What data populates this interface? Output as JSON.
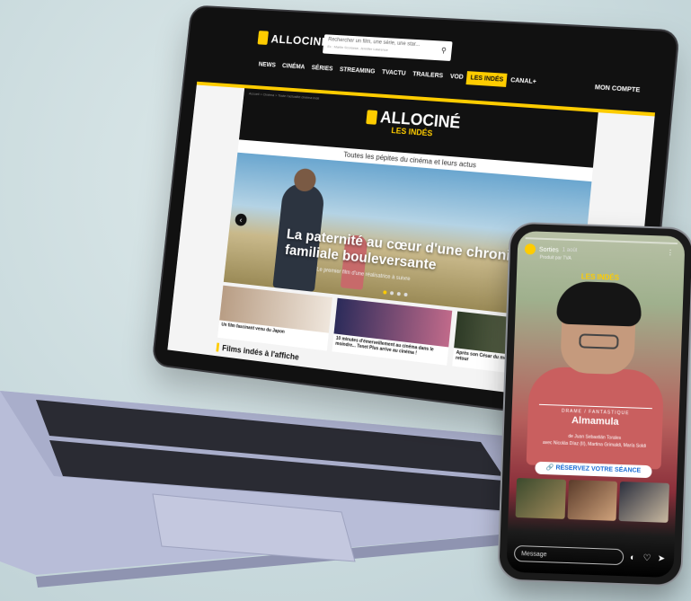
{
  "laptop": {
    "site": {
      "logo_text": "ALLOCINÉ",
      "search_placeholder": "Rechercher un film, une série, une star...",
      "search_hint": "Ex : Martin Scorsese, Jennifer Lawrence",
      "nav_items": [
        "NEWS",
        "CINÉMA",
        "SÉRIES",
        "STREAMING",
        "TVACTU",
        "TRAILERS",
        "VOD",
        "LES INDÉS",
        "CANAL+"
      ],
      "active_nav": "LES INDÉS",
      "account_label": "MON COMPTE",
      "breadcrumb": "Accueil > Cinéma > Toute l'actualité cinéma indé",
      "brand_main": "ALLOCINÉ",
      "brand_sub": "LES INDÉS",
      "tagline": "Toutes les pépites du cinéma et leurs actus",
      "hero_title": "La paternité au cœur d'une chronique familiale bouleversante",
      "hero_sub": "Le premier film d'une réalisatrice à suivre",
      "cards": [
        {
          "caption": "Un film fascinant venu du Japon"
        },
        {
          "caption": "10 minutes d'émerveillement au cinéma dans le moindre... Tenet Plus arrive au cinéma !"
        },
        {
          "caption": "Après son César du meilleur acteur, il fait son grand retour"
        }
      ],
      "section_title": "Films indés à l'affiche"
    }
  },
  "phone": {
    "story_user": "Sorties",
    "story_time": "1 août",
    "story_sub": "Produit par TVA",
    "logo": "LES INDÉS",
    "film_tag": "DRAME / FANTASTIQUE",
    "film_title": "Almamula",
    "film_director": "de Juan Sebastián Torales",
    "film_cast": "avec Nicolás Díaz (II), Martina Grimaldi, María Soldi",
    "cta_label": "RÉSERVEZ VOTRE SÉANCE",
    "message_placeholder": "Message"
  },
  "colors": {
    "accent": "#fecc00",
    "dark": "#111111"
  }
}
